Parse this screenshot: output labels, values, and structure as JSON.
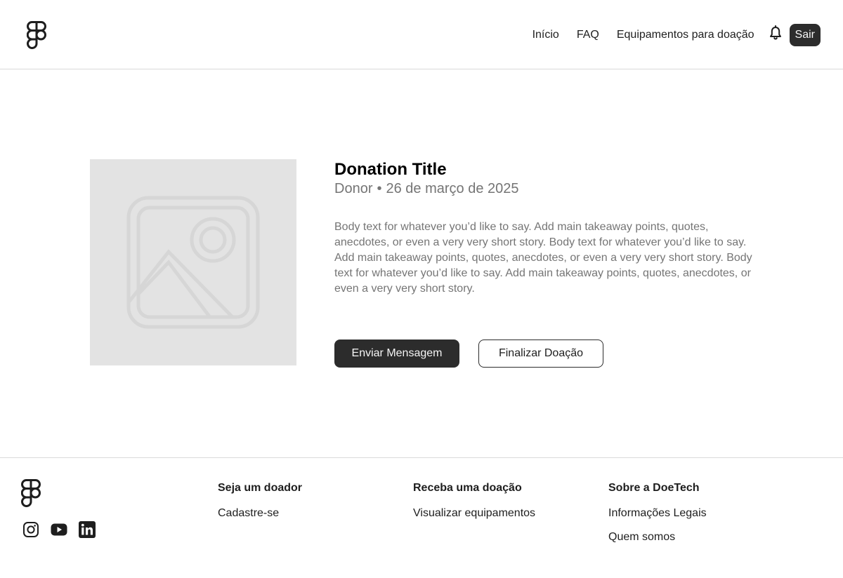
{
  "header": {
    "nav": {
      "home": "Início",
      "faq": "FAQ",
      "equipment": "Equipamentos para doação"
    },
    "logout_label": "Sair"
  },
  "donation": {
    "title": "Donation Title",
    "donor": "Donor",
    "separator": "•",
    "date": "26 de março de 2025",
    "body": "Body text for whatever you’d like to say. Add main takeaway points, quotes, anecdotes, or even a very very short story. Body text for whatever you’d like to say. Add main takeaway points, quotes, anecdotes, or even a very very short story. Body text for whatever you’d like to say. Add main takeaway points, quotes, anecdotes, or even a very very short story.",
    "send_message_label": "Enviar Mensagem",
    "finalize_label": "Finalizar Doação"
  },
  "footer": {
    "socials": [
      "instagram-icon",
      "youtube-icon",
      "linkedin-icon"
    ],
    "columns": [
      {
        "title": "Seja um doador",
        "links": [
          "Cadastre-se"
        ]
      },
      {
        "title": "Receba uma doação",
        "links": [
          "Visualizar equipamentos"
        ]
      },
      {
        "title": "Sobre a DoeTech",
        "links": [
          "Informações Legais",
          "Quem somos"
        ]
      }
    ]
  },
  "colors": {
    "primary": "#2c2c2c",
    "muted_text": "#757575",
    "placeholder_bg": "#e3e3e3",
    "divider": "#d9d9d9"
  }
}
